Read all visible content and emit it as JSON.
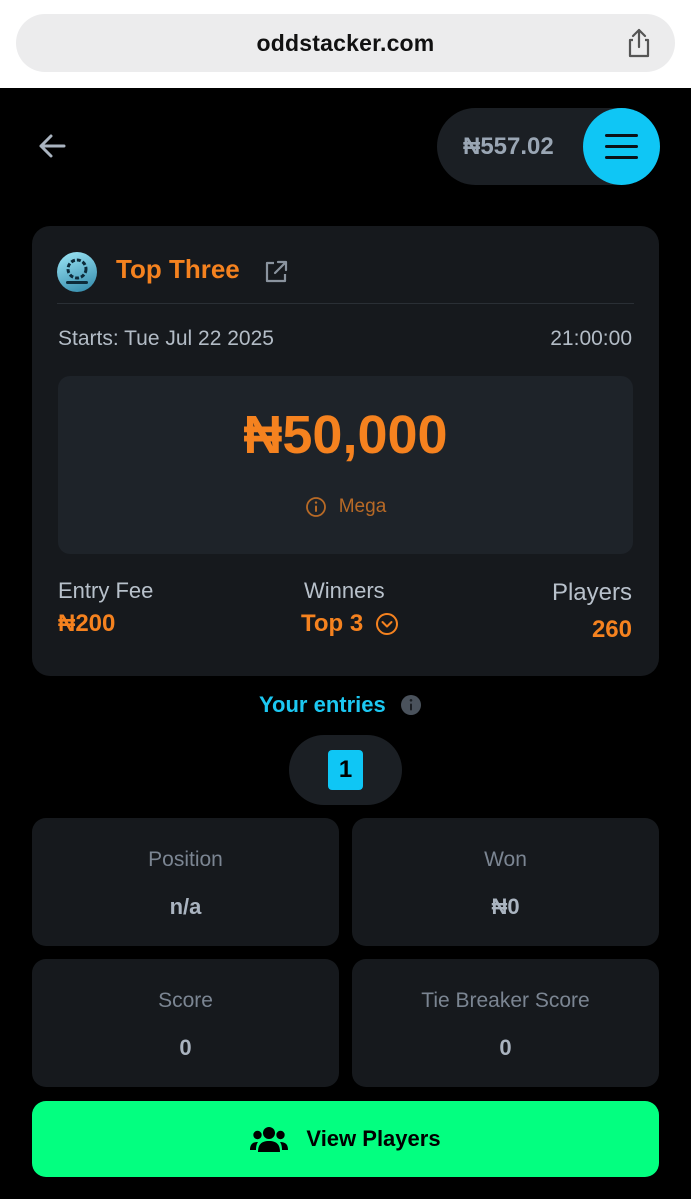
{
  "browser": {
    "url": "oddstacker.com"
  },
  "header": {
    "wallet_balance": "₦557.02"
  },
  "contest": {
    "title": "Top Three",
    "starts": "Starts: Tue Jul 22 2025",
    "time": "21:00:00",
    "prize": "₦50,000",
    "tier": "Mega",
    "entry_fee_label": "Entry Fee",
    "entry_fee": "₦200",
    "winners_label": "Winners",
    "winners": "Top 3",
    "players_label": "Players",
    "players": "260"
  },
  "entries": {
    "title": "Your entries",
    "tabs": [
      "1"
    ]
  },
  "stats": {
    "position_label": "Position",
    "position_value": "n/a",
    "won_label": "Won",
    "won_value": "₦0",
    "score_label": "Score",
    "score_value": "0",
    "tiebreak_label": "Tie Breaker Score",
    "tiebreak_value": "0"
  },
  "actions": {
    "view_players_label": "View Players"
  },
  "colors": {
    "accent_orange": "#f5821f",
    "accent_cyan": "#0fc6f5",
    "accent_green": "#03ff80",
    "card_bg": "#16191d"
  },
  "icons": [
    "share-icon",
    "back-arrow-icon",
    "hamburger-menu-icon",
    "external-link-icon",
    "info-circle-icon",
    "chevron-down-circle-icon",
    "users-icon"
  ]
}
